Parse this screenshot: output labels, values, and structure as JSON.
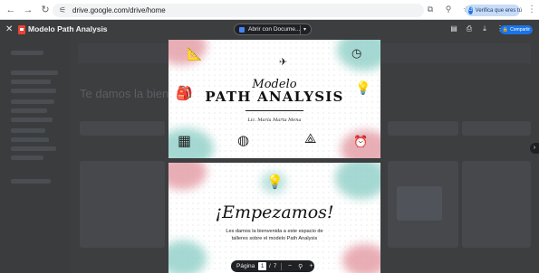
{
  "browser": {
    "url": "drive.google.com/drive/home",
    "verify_label": "Verifica que eres tú",
    "icons": [
      "back-arrow-icon",
      "forward-arrow-icon",
      "reload-icon",
      "tune-icon",
      "install-icon",
      "zoom-icon",
      "star-icon",
      "menu-kebab-icon"
    ]
  },
  "drive_background": {
    "welcome_text": "Te damos la bienvenida a Drive"
  },
  "viewer": {
    "file_title": "Modelo Path Analysis",
    "open_with_label": "Abrir con Docume...",
    "share_label": "Compartir",
    "accent_color": "#1a73e8",
    "pdf_color": "#ea4335"
  },
  "slides": {
    "slide1": {
      "modelo": "Modelo",
      "title": "PATH ANALYSIS",
      "author": "Lic. María Marta Mena"
    },
    "slide2": {
      "title": "¡Empezamos!",
      "body_line1": "Les damos la bienvenida a este espacio de",
      "body_line2": "talleres sobre el modelo Path Analysis"
    },
    "splash_colors": [
      "#e39aa3",
      "#8fcfc7"
    ]
  },
  "pager": {
    "label": "Página",
    "current": "1",
    "separator": "/",
    "total": "7",
    "zoom_out": "−",
    "zoom_in": "+"
  }
}
